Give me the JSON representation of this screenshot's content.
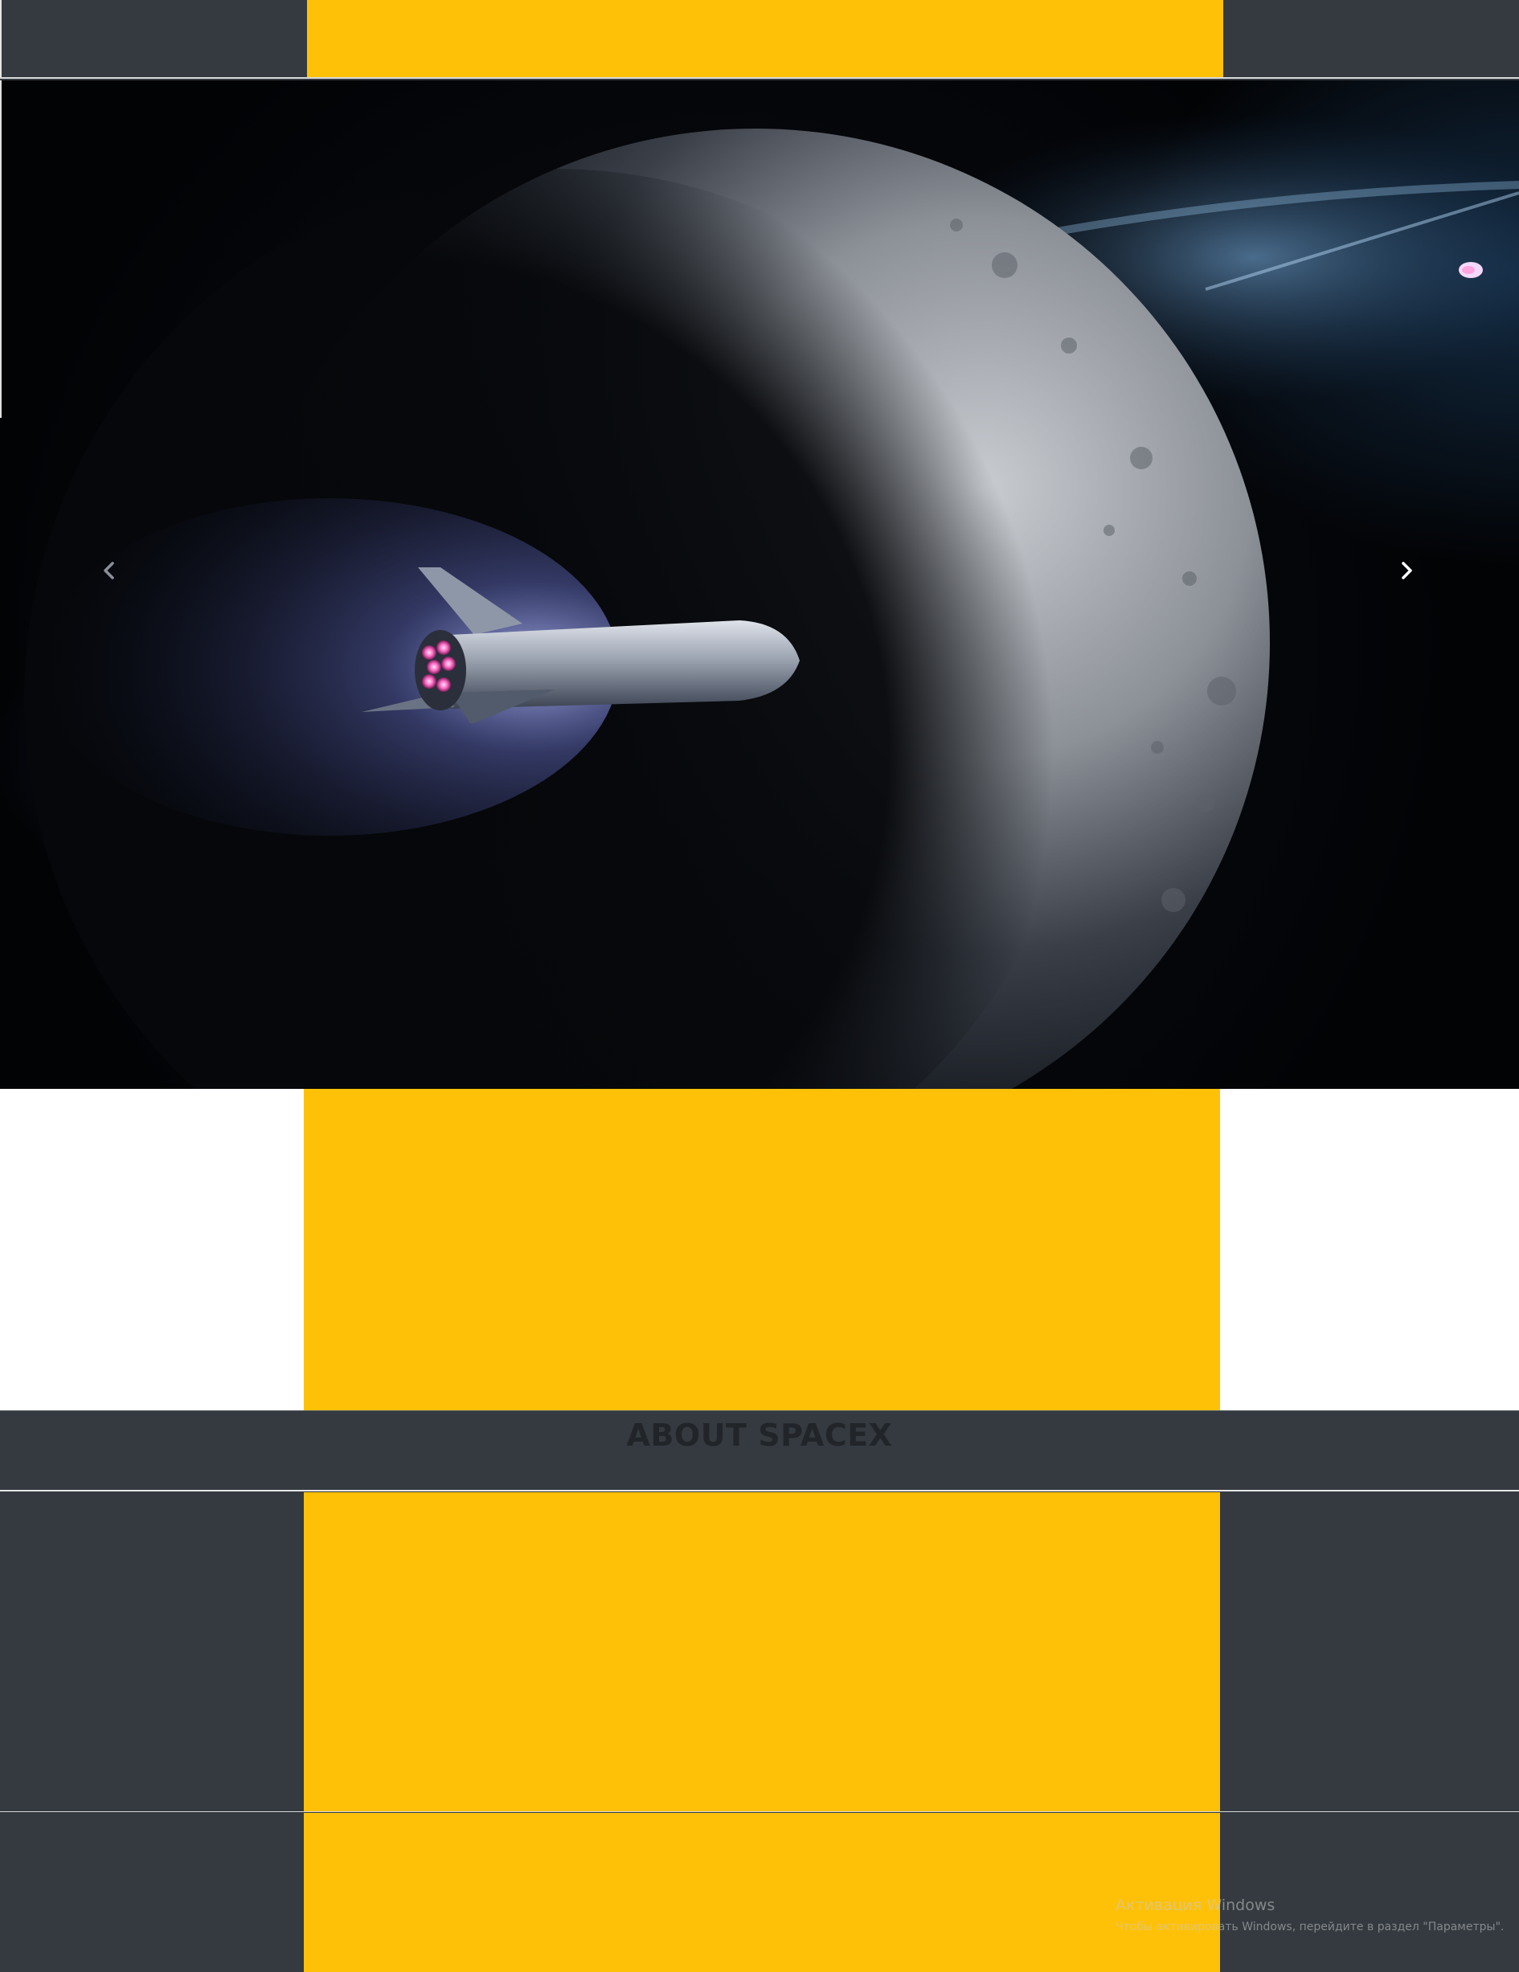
{
  "header": {
    "accent_color": "#ffc107",
    "background_color": "#343a40"
  },
  "carousel": {
    "prev_icon": "chevron-left-icon",
    "next_icon": "chevron-right-icon",
    "slide_image": "starship-moon-image"
  },
  "about": {
    "title": "ABOUT SPACEX"
  },
  "os_overlay": {
    "title": "Активация Windows",
    "subtitle": "Чтобы активировать Windows, перейдите в раздел \"Параметры\"."
  }
}
